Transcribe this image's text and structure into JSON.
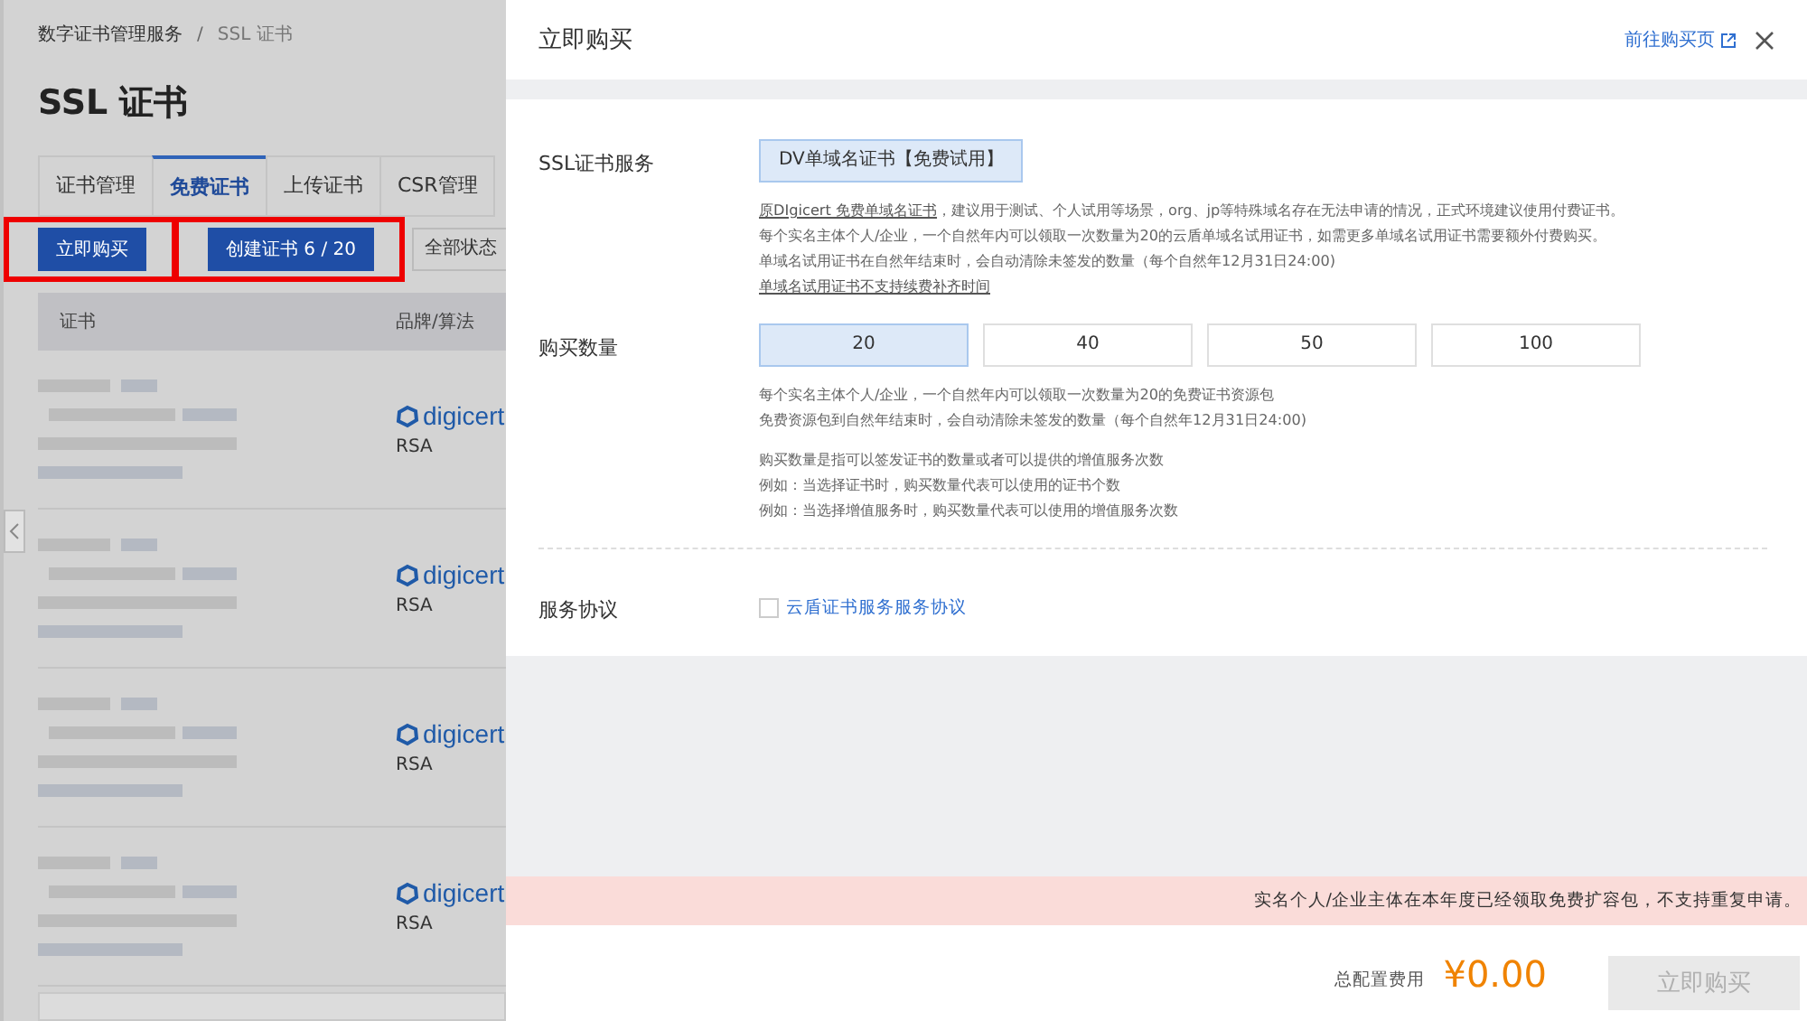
{
  "breadcrumb": [
    "数字证书管理服务",
    "SSL 证书"
  ],
  "breadcrumb_separator": "/",
  "page_title": "SSL 证书",
  "tabs": [
    {
      "label": "证书管理",
      "selected": false
    },
    {
      "label": "免费证书",
      "selected": true
    },
    {
      "label": "上传证书",
      "selected": false
    },
    {
      "label": "CSR管理",
      "selected": false
    }
  ],
  "actions": [
    {
      "label": "立即购买",
      "highlighted": true
    },
    {
      "label": "创建证书 6 / 20",
      "highlighted": true
    }
  ],
  "status_filter": "全部状态",
  "table": {
    "columns": [
      "证书",
      "品牌/算法"
    ],
    "rows": [
      {
        "brand": "digicert",
        "algorithm": "RSA"
      },
      {
        "brand": "digicert",
        "algorithm": "RSA"
      },
      {
        "brand": "digicert",
        "algorithm": "RSA"
      },
      {
        "brand": "digicert",
        "algorithm": "RSA"
      }
    ]
  },
  "drawer": {
    "title": "立即购买",
    "link": "前往购买页",
    "sections": [
      {
        "kind": "options",
        "label": "SSL证书服务",
        "options": [
          {
            "label": "DV单域名证书【免费试用】",
            "selected": true
          }
        ],
        "notes": [
          [
            [
              {
                "text": "原DIgicert 免费单域名证书",
                "kind": "link"
              },
              {
                "text": "，建议用于测试、个人试用等场景，org、jp等特殊域名存在无法申请的情况，正式环境建议使用付费证书。",
                "kind": "text"
              }
            ],
            [
              {
                "text": "每个实名主体个人/企业，一个自然年内可以领取一次数量为20的云盾单域名试用证书，如需更多单域名试用证书需要额外付费购买。",
                "kind": "text"
              }
            ],
            [
              {
                "text": "单域名试用证书在自然年结束时，会自动清除未签发的数量（每个自然年12月31日24:00)",
                "kind": "text"
              }
            ],
            [
              {
                "text": "单域名试用证书不支持续费补齐时间",
                "kind": "link"
              }
            ]
          ]
        ]
      },
      {
        "kind": "options",
        "label": "购买数量",
        "options": [
          {
            "label": "20",
            "selected": true
          },
          {
            "label": "40",
            "selected": false
          },
          {
            "label": "50",
            "selected": false
          },
          {
            "label": "100",
            "selected": false
          }
        ],
        "notes": [
          [
            [
              {
                "text": "每个实名主体个人/企业，一个自然年内可以领取一次数量为20的免费证书资源包",
                "kind": "text"
              }
            ],
            [
              {
                "text": "免费资源包到自然年结束时，会自动清除未签发的数量（每个自然年12月31日24:00)",
                "kind": "text"
              }
            ]
          ],
          [
            [
              {
                "text": "购买数量是指可以签发证书的数量或者可以提供的增值服务次数",
                "kind": "text"
              }
            ],
            [
              {
                "text": "例如：当选择证书时，购买数量代表可以使用的证书个数",
                "kind": "text"
              }
            ],
            [
              {
                "text": "例如：当选择增值服务时，购买数量代表可以使用的增值服务次数",
                "kind": "text"
              }
            ]
          ]
        ]
      },
      {
        "kind": "agreement",
        "label": "服务协议",
        "checked": false,
        "link": "云盾证书服务服务协议"
      }
    ],
    "alert": "实名个人/企业主体在本年度已经领取免费扩容包，不支持重复申请。",
    "total_label": "总配置费用",
    "price": "¥0.00",
    "buy_button": {
      "label": "立即购买",
      "disabled": true
    }
  }
}
